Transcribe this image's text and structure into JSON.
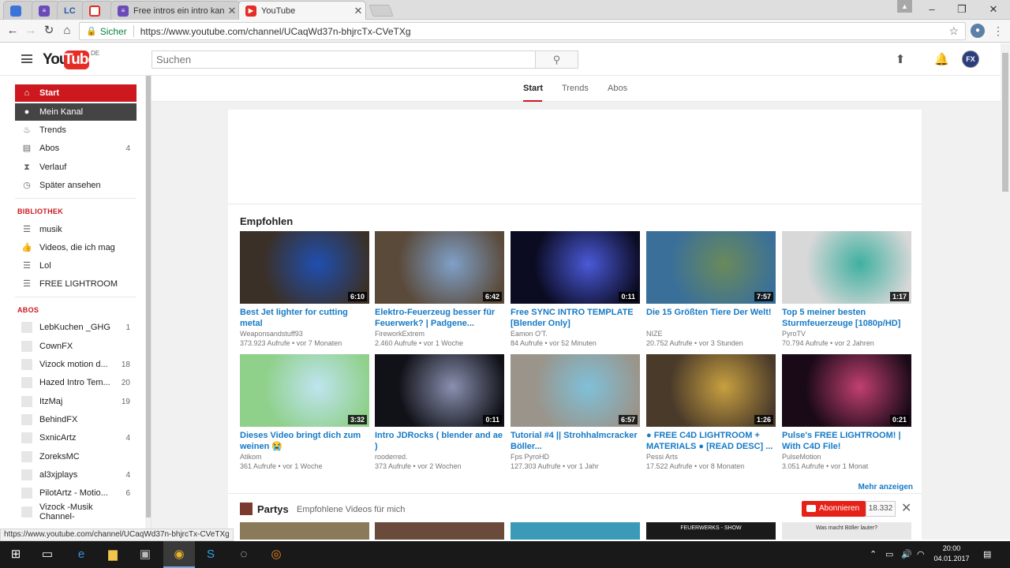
{
  "browser": {
    "tabs": [
      {
        "title": "",
        "icon": "chrome-icon",
        "color": "#3b74d8"
      },
      {
        "title": "",
        "icon": "forms-icon",
        "color": "#6b4bb8"
      },
      {
        "title": "LC",
        "icon": "lc-icon",
        "color": "#2b5aa8"
      },
      {
        "title": "",
        "icon": "tab-icon",
        "color": "#d93025"
      },
      {
        "title": "Free intros ein intro kann",
        "icon": "forms-icon",
        "color": "#6b4bb8"
      },
      {
        "title": "YouTube",
        "icon": "youtube-icon",
        "color": "#e52d27"
      }
    ],
    "secure_label": "Sicher",
    "url": "https://www.youtube.com/channel/UCaqWd37n-bhjrcTx-CVeTXg",
    "status_url": "https://www.youtube.com/channel/UCaqWd37n-bhjrcTx-CVeTXg"
  },
  "masthead": {
    "logo_you": "You",
    "logo_tube": "Tube",
    "region": "DE",
    "search_placeholder": "Suchen"
  },
  "sidebar": {
    "main": [
      {
        "label": "Start",
        "icon": "home-icon",
        "count": ""
      },
      {
        "label": "Mein Kanal",
        "icon": "account-icon",
        "count": ""
      },
      {
        "label": "Trends",
        "icon": "flame-icon",
        "count": ""
      },
      {
        "label": "Abos",
        "icon": "subscriptions-icon",
        "count": "4"
      },
      {
        "label": "Verlauf",
        "icon": "hourglass-icon",
        "count": ""
      },
      {
        "label": "Später ansehen",
        "icon": "clock-icon",
        "count": ""
      }
    ],
    "library_heading": "BIBLIOTHEK",
    "library": [
      {
        "label": "musik",
        "icon": "playlist-icon"
      },
      {
        "label": "Videos, die ich mag",
        "icon": "thumbs-up-icon"
      },
      {
        "label": "Lol",
        "icon": "playlist-icon"
      },
      {
        "label": "FREE LIGHTROOM",
        "icon": "playlist-icon"
      }
    ],
    "subs_heading": "ABOS",
    "subs": [
      {
        "label": "LebKuchen _GHG",
        "count": "1"
      },
      {
        "label": "CownFX",
        "count": ""
      },
      {
        "label": "Vizock motion d...",
        "count": "18"
      },
      {
        "label": "Hazed Intro Tem...",
        "count": "20"
      },
      {
        "label": "ItzMaj",
        "count": "19"
      },
      {
        "label": "BehindFX",
        "count": ""
      },
      {
        "label": "SxnicArtz",
        "count": "4"
      },
      {
        "label": "ZoreksMC",
        "count": ""
      },
      {
        "label": "al3xjplays",
        "count": "4"
      },
      {
        "label": "PilotArtz - Motio...",
        "count": "6"
      },
      {
        "label": "Vizock -Musik Channel-",
        "count": ""
      }
    ]
  },
  "subnav": {
    "tabs": [
      "Start",
      "Trends",
      "Abos"
    ]
  },
  "recommended": {
    "title": "Empfohlen",
    "more": "Mehr anzeigen",
    "videos": [
      {
        "title": "Best Jet lighter for cutting metal",
        "channel": "Weaponsandstuff93",
        "meta": "373.923 Aufrufe • vor 7 Monaten",
        "duration": "6:10",
        "bg": "#3a3028",
        "accent": "#1f4fb0"
      },
      {
        "title": "Elektro-Feuerzeug besser für Feuerwerk? | Padgene...",
        "channel": "FireworkExtrem",
        "meta": "2.460 Aufrufe • vor 1 Woche",
        "duration": "6:42",
        "bg": "#5a4a3a",
        "accent": "#7fa0c8"
      },
      {
        "title": "Free SYNC INTRO TEMPLATE [Blender Only]",
        "channel": "Eamon O'T.",
        "meta": "84 Aufrufe • vor 52 Minuten",
        "duration": "0:11",
        "bg": "#0b0b22",
        "accent": "#4a5ad8"
      },
      {
        "title": "Die 15 Größten Tiere Der Welt!",
        "channel": "NIZE",
        "meta": "20.752 Aufrufe • vor 3 Stunden",
        "duration": "7:57",
        "bg": "#3a6f9a",
        "accent": "#6a8a5a"
      },
      {
        "title": "Top 5 meiner besten Sturmfeuerzeuge [1080p/HD]",
        "channel": "PyroTV",
        "meta": "70.794 Aufrufe • vor 2 Jahren",
        "duration": "1:17",
        "bg": "#d8d8d8",
        "accent": "#3fb0a0"
      },
      {
        "title": "Dieses Video bringt dich zum weinen 😭",
        "channel": "Atikom",
        "meta": "361 Aufrufe • vor 1 Woche",
        "duration": "3:32",
        "bg": "#8fd08a",
        "accent": "#bfe4f0"
      },
      {
        "title": "Intro JDRocks ( blender and ae )",
        "channel": "rooderred.",
        "meta": "373 Aufrufe • vor 2 Wochen",
        "duration": "0:11",
        "bg": "#111218",
        "accent": "#8a90b0"
      },
      {
        "title": "Tutorial #4 || Strohhalmcracker Böller...",
        "channel": "Fps PyroHD",
        "meta": "127.303 Aufrufe • vor 1 Jahr",
        "duration": "6:57",
        "bg": "#9a948a",
        "accent": "#7fc0d8"
      },
      {
        "title": "● FREE C4D LIGHTROOM + MATERIALS ● [READ DESC] ...",
        "channel": "Pessi Arts",
        "meta": "17.522 Aufrufe • vor 8 Monaten",
        "duration": "1:26",
        "bg": "#4a3a2a",
        "accent": "#c8a040"
      },
      {
        "title": "Pulse's FREE LIGHTROOM! | With C4D File!",
        "channel": "PulseMotion",
        "meta": "3.051 Aufrufe • vor 1 Monat",
        "duration": "0:21",
        "bg": "#1a0a18",
        "accent": "#c04070"
      }
    ]
  },
  "parties": {
    "title": "Partys",
    "subtitle": "Empfohlene Videos für mich",
    "subscribe": "Abonnieren",
    "subscriber_count": "18.332",
    "thumb_colors": [
      "#8a7a5a",
      "#6a4a3a",
      "#3a9ab8",
      "#1a1a1a",
      "#e8e8e8"
    ],
    "thumb_texts": [
      "",
      "",
      "",
      "FEUERWERKS - SHOW",
      "Was macht Böller lauter?"
    ]
  },
  "taskbar": {
    "time": "20:00",
    "date": "04.01.2017"
  }
}
